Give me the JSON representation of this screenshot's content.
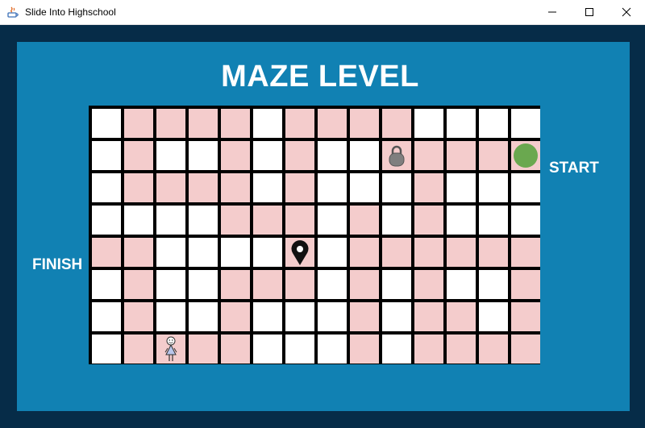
{
  "window": {
    "title": "Slide Into Highschool",
    "icon": "java-icon",
    "controls": [
      "minimize-icon",
      "maximize-icon",
      "close-icon"
    ]
  },
  "game": {
    "heading": "MAZE LEVEL",
    "start_label": "START",
    "finish_label": "FINISH",
    "colors": {
      "outer_background": "#062c48",
      "inner_background": "#1181b3",
      "cell_path": "#f4cccc",
      "cell_wall": "#ffffff",
      "grid_lines": "#000000",
      "start_marker": "#6aa84f"
    },
    "grid": {
      "rows": 8,
      "cols": 14,
      "cells": [
        "WPPPPWPPPPWWWW",
        "WPWWPWPWWPPPPP",
        "WPPPPWPWWWPWWW",
        "WWWWPPPWPWPWWW",
        "PPWWWWPWPPPPPP",
        "WPWWPPPWPWPWWP",
        "WPWWPWWWPWPPWP",
        "WPPPPWWWPWPPPP"
      ]
    },
    "items": [
      {
        "name": "start-marker",
        "icon": "green-circle-icon",
        "row": 1,
        "col": 13
      },
      {
        "name": "lock",
        "icon": "padlock-icon",
        "row": 1,
        "col": 9
      },
      {
        "name": "location-pin",
        "icon": "map-pin-icon",
        "row": 4,
        "col": 6
      },
      {
        "name": "player",
        "icon": "stick-figure-icon",
        "row": 7,
        "col": 2
      }
    ]
  }
}
